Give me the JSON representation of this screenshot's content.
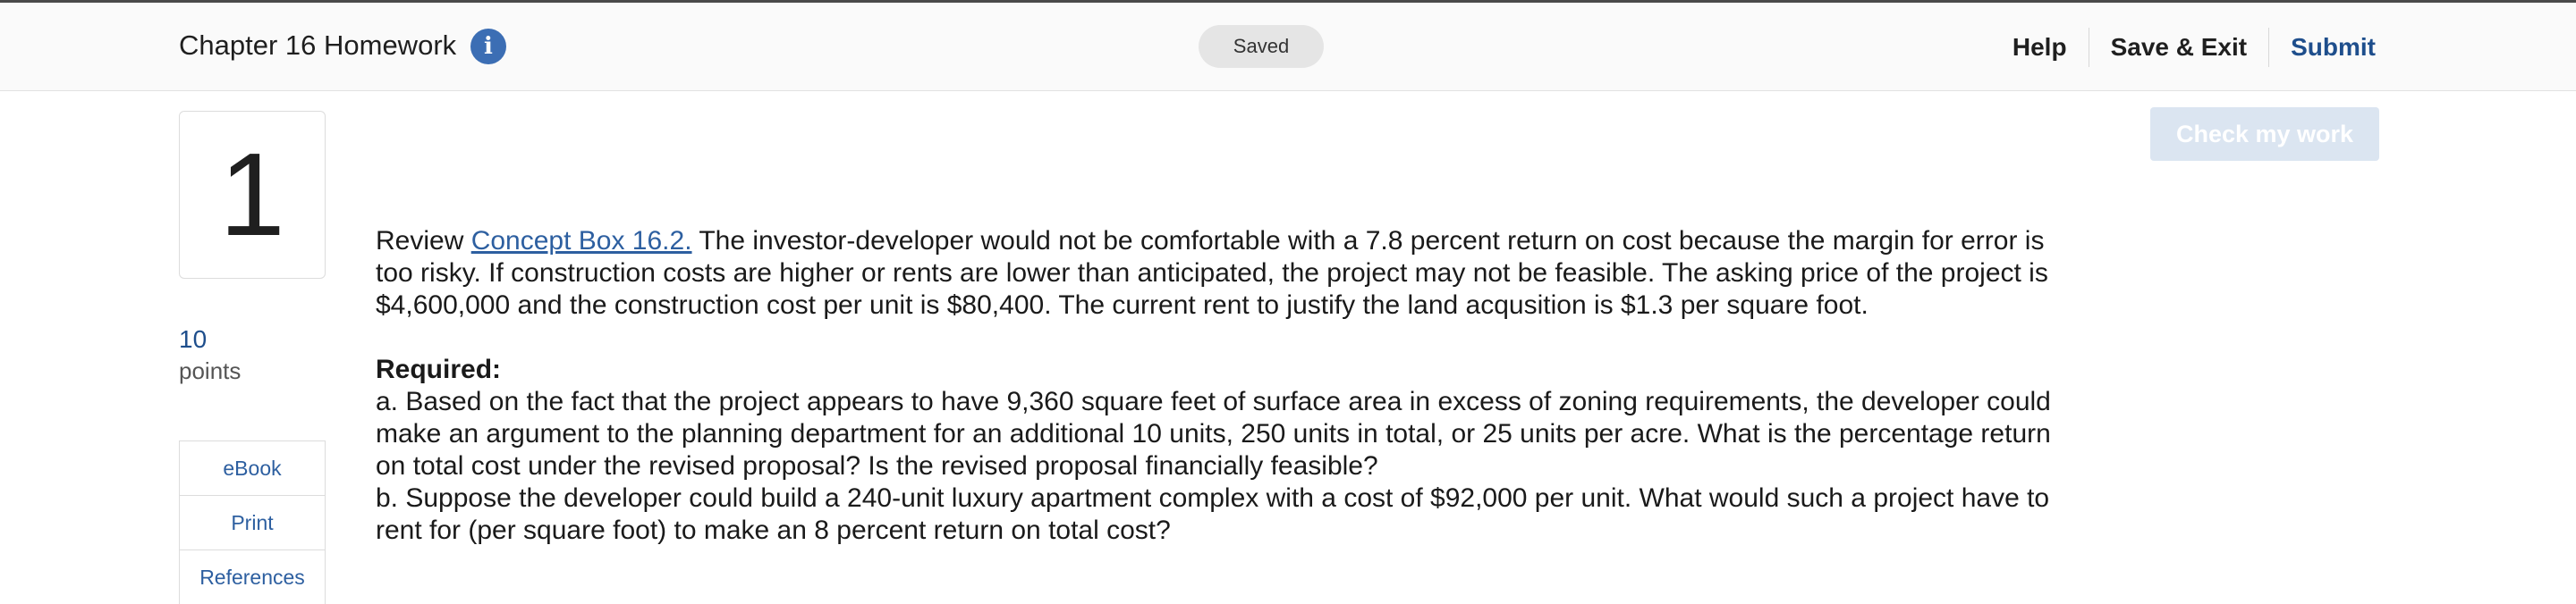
{
  "header": {
    "title": "Chapter 16 Homework",
    "info_icon": "info-icon",
    "saved_status": "Saved",
    "nav": {
      "help": "Help",
      "save_exit": "Save & Exit",
      "submit": "Submit"
    }
  },
  "question": {
    "number": "1",
    "points_value": "10",
    "points_label": "points",
    "resources": [
      "eBook",
      "Print",
      "References"
    ],
    "check_label": "Check my work",
    "intro_prefix": "Review ",
    "concept_link": "Concept Box 16.2.",
    "intro_body": " The investor-developer would not be comfortable with a 7.8 percent return on cost because the margin for error is too risky. If construction costs are higher or rents are lower than anticipated, the project may not be feasible. The asking price of the project is $4,600,000 and the construction cost per unit is $80,400. The current rent to justify the land acqusition is $1.3 per square foot.",
    "required_label": "Required:",
    "part_a": "a. Based on the fact that the project appears to have 9,360 square feet of surface area in excess of zoning requirements, the developer could make an argument to the planning department for an additional 10 units, 250 units in total, or 25 units per acre. What is the percentage return on total cost under the revised proposal? Is the revised proposal financially feasible?",
    "part_b": "b. Suppose the developer could build a 240-unit luxury apartment complex with a cost of $92,000 per unit. What would such a project have to rent for (per square foot) to make an 8 percent return on total cost?"
  },
  "colors": {
    "accent_blue": "#3c6eb4",
    "link_blue": "#2d5fa0",
    "submit_blue": "#1e4e8c",
    "check_button_bg": "#dbe5f1"
  }
}
